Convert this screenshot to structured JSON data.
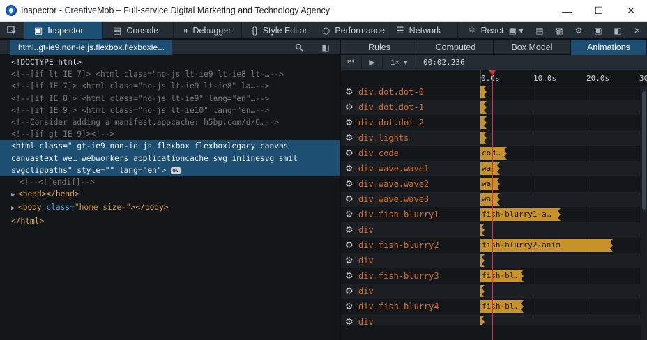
{
  "window": {
    "title": "Inspector - CreativeMob – Full-service Digital Marketing and Technology Agency"
  },
  "toolbar": {
    "tabs": [
      {
        "label": "Inspector",
        "icon": "inspector-icon",
        "active": true
      },
      {
        "label": "Console",
        "icon": "console-icon"
      },
      {
        "label": "Debugger",
        "icon": "debugger-icon"
      },
      {
        "label": "Style Editor",
        "icon": "style-editor-icon"
      },
      {
        "label": "Performance",
        "icon": "performance-icon"
      },
      {
        "label": "Network",
        "icon": "network-icon"
      },
      {
        "label": "React",
        "icon": "react-icon"
      }
    ]
  },
  "breadcrumb": {
    "label": "html..gt-ie9.non-ie.js.flexbox.flexboxle..."
  },
  "markup": {
    "doctype": "<!DOCTYPE html>",
    "comments": [
      "<!--[if lt IE 7]> <html class=\"no-js lt-ie9 lt-ie8 lt-…-->",
      "<!--[if IE 7]> <html class=\"no-js lt-ie9 lt-ie8\" la…-->",
      "<!--[if IE 8]> <html class=\"no-js lt-ie9\" lang=\"en\"…-->",
      "<!--[if IE 9]> <html class=\"no-js lt-ie10\" lang=\"en…-->",
      "<!--Consider adding a manifest.appcache: h5bp.com/d/O…-->",
      "<!--[if gt IE 9]><!-->"
    ],
    "selected": {
      "line1_tag": "<html",
      "line1_attr": " class=",
      "line1_val": "\" gt-ie9 non-ie js flexbox flexboxlegacy canvas",
      "line2": "canvastext we… webworkers applicationcache svg inlinesvg smil",
      "line3_val": "svgclippaths\"",
      "line3_attr2": " style=",
      "line3_val2": "\"\"",
      "line3_attr3": " lang=",
      "line3_val3": "\"en\"",
      "line3_end": ">",
      "event_badge": "ev"
    },
    "endif_comment": "<!--<![endif]-->",
    "head": "<head></head>",
    "body_open": "<body",
    "body_attr": " class=",
    "body_val": "\"home size-\"",
    "body_close": "></body>",
    "html_close": "</html>"
  },
  "sidebar": {
    "tabs": [
      {
        "label": "Rules"
      },
      {
        "label": "Computed"
      },
      {
        "label": "Box Model"
      },
      {
        "label": "Animations",
        "active": true
      }
    ]
  },
  "animations": {
    "rate": "1×",
    "current_time": "00:02.236",
    "ticks": [
      "0.0s",
      "10.0s",
      "20.0s",
      "30"
    ],
    "rows": [
      {
        "tag": "div",
        "classes": ".dot.dot-0",
        "label": ""
      },
      {
        "tag": "div",
        "classes": ".dot.dot-1",
        "label": ""
      },
      {
        "tag": "div",
        "classes": ".dot.dot-2",
        "label": ""
      },
      {
        "tag": "div",
        "classes": ".lights",
        "label": ""
      },
      {
        "tag": "div",
        "classes": ".code",
        "label": "cod…"
      },
      {
        "tag": "div",
        "classes": ".wave.wave1",
        "label": "wa…"
      },
      {
        "tag": "div",
        "classes": ".wave.wave2",
        "label": "wa…"
      },
      {
        "tag": "div",
        "classes": ".wave.wave3",
        "label": "wa…"
      },
      {
        "tag": "div",
        "classes": ".fish-blurry1",
        "label": "fish-blurry1-a…"
      },
      {
        "tag": "div",
        "classes": "",
        "label": ""
      },
      {
        "tag": "div",
        "classes": ".fish-blurry2",
        "label": "fish-blurry2-anim"
      },
      {
        "tag": "div",
        "classes": "",
        "label": ""
      },
      {
        "tag": "div",
        "classes": ".fish-blurry3",
        "label": "fish-bl…"
      },
      {
        "tag": "div",
        "classes": "",
        "label": ""
      },
      {
        "tag": "div",
        "classes": ".fish-blurry4",
        "label": "fish-bl…"
      },
      {
        "tag": "div",
        "classes": "",
        "label": ""
      }
    ]
  },
  "colors": {
    "accent": "#1d4f73",
    "animation_bar": "#c79227",
    "scrubber": "#e22f35",
    "tag_name": "#d56b26"
  }
}
